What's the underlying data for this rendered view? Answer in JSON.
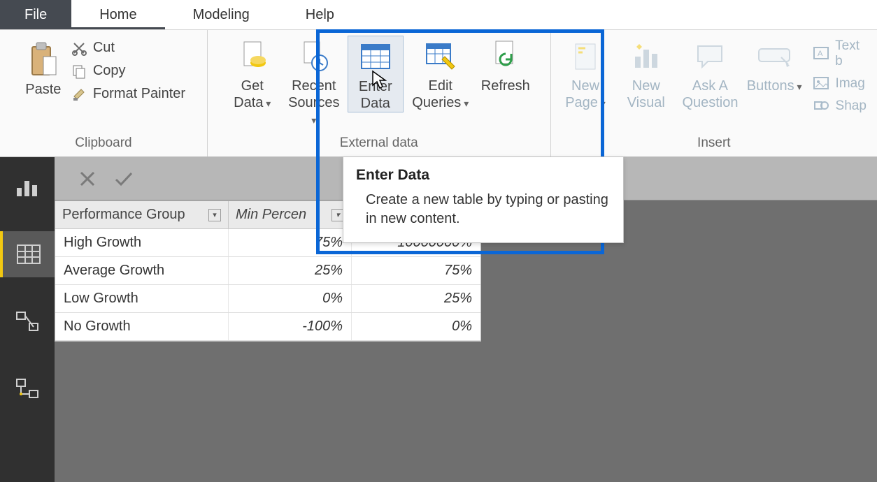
{
  "menu": {
    "file": "File",
    "home": "Home",
    "modeling": "Modeling",
    "help": "Help"
  },
  "clipboard": {
    "paste": "Paste",
    "cut": "Cut",
    "copy": "Copy",
    "format_painter": "Format Painter",
    "group": "Clipboard"
  },
  "external": {
    "get_data": "Get\nData",
    "recent_sources": "Recent\nSources",
    "enter_data": "Enter\nData",
    "edit_queries": "Edit\nQueries",
    "refresh": "Refresh",
    "group": "External data"
  },
  "insert": {
    "new_page": "New\nPage",
    "new_visual": "New\nVisual",
    "ask": "Ask A\nQuestion",
    "buttons": "Buttons",
    "group": "Insert",
    "text_box": "Text b",
    "image": "Imag",
    "shapes": "Shap"
  },
  "tooltip": {
    "title": "Enter Data",
    "body": "Create a new table by typing or pasting in new content."
  },
  "table": {
    "headers": [
      "Performance Group",
      "Min Percen",
      ""
    ],
    "rows": [
      {
        "a": "High Growth",
        "b": "75%",
        "c": "10000000%"
      },
      {
        "a": "Average Growth",
        "b": "25%",
        "c": "75%"
      },
      {
        "a": "Low Growth",
        "b": "0%",
        "c": "25%"
      },
      {
        "a": "No Growth",
        "b": "-100%",
        "c": "0%"
      }
    ]
  }
}
